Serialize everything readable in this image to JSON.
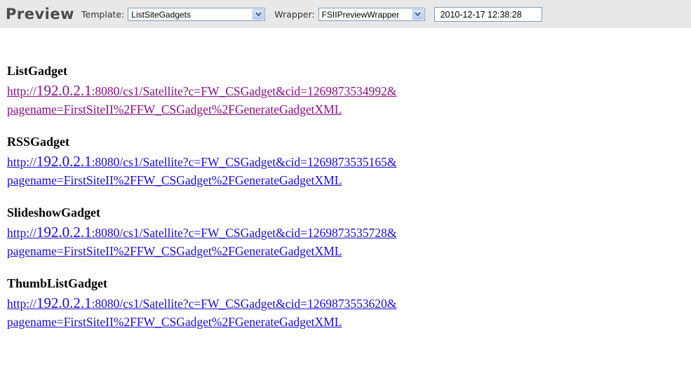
{
  "toolbar": {
    "title": "Preview",
    "template_label": "Template:",
    "template_value": "ListSiteGadgets",
    "wrapper_label": "Wrapper:",
    "wrapper_value": "FSIIPreviewWrapper",
    "datetime_value": "2010-12-17 12:38:28"
  },
  "gadgets": [
    {
      "name": "ListGadget",
      "url_prefix": "http://",
      "url_host": "192.0.2.1",
      "url_line1": ":8080/cs1/Satellite?c=FW_CSGadget&cid=1269873534992&",
      "url_line2": "pagename=FirstSiteII%2FFW_CSGadget%2FGenerateGadgetXML",
      "visited": true
    },
    {
      "name": "RSSGadget",
      "url_prefix": "http://",
      "url_host": "192.0.2.1",
      "url_line1": ":8080/cs1/Satellite?c=FW_CSGadget&cid=1269873535165&",
      "url_line2": "pagename=FirstSiteII%2FFW_CSGadget%2FGenerateGadgetXML",
      "visited": false
    },
    {
      "name": "SlideshowGadget",
      "url_prefix": "http://",
      "url_host": "192.0.2.1",
      "url_line1": ":8080/cs1/Satellite?c=FW_CSGadget&cid=1269873535728&",
      "url_line2": "pagename=FirstSiteII%2FFW_CSGadget%2FGenerateGadgetXML",
      "visited": false
    },
    {
      "name": "ThumbListGadget",
      "url_prefix": "http://",
      "url_host": "192.0.2.1",
      "url_line1": ":8080/cs1/Satellite?c=FW_CSGadget&cid=1269873553620&",
      "url_line2": "pagename=FirstSiteII%2FFW_CSGadget%2FGenerateGadgetXML",
      "visited": false
    }
  ]
}
